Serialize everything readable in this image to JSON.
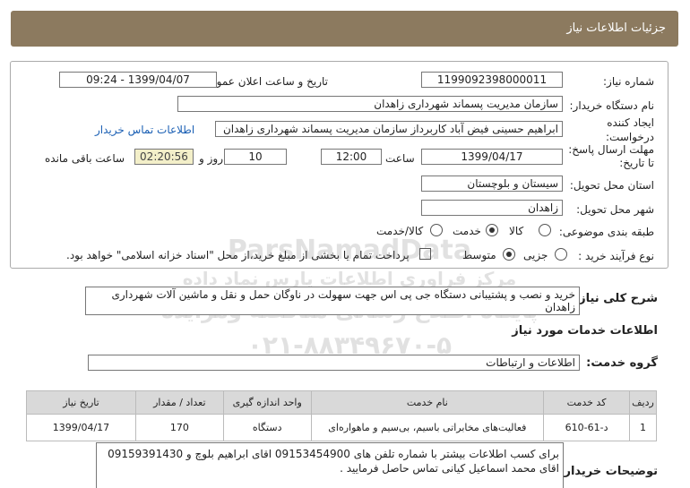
{
  "header": {
    "title": "جزئیات اطلاعات نیاز"
  },
  "need": {
    "number_label": "شماره نیاز:",
    "number": "1199092398000011",
    "announce_label": "تاریخ و ساعت اعلان عمومی:",
    "announce_value": "1399/04/07 - 09:24",
    "buyer_label": "نام دستگاه خریدار:",
    "buyer": "سازمان مدیریت پسماند شهرداری زاهدان",
    "creator_label_1": "ایجاد کننده",
    "creator_label_2": "درخواست:",
    "creator": "ابراهیم حسینی فیض آباد کاربرداز سازمان مدیریت پسماند شهرداری زاهدان",
    "contact_link": "اطلاعات تماس خریدار",
    "deadline_label_1": "مهلت ارسال پاسخ:",
    "deadline_label_2": "تا تاریخ:",
    "deadline_date": "1399/04/17",
    "time_label": "ساعت",
    "deadline_time": "12:00",
    "days_value": "10",
    "days_label": "روز و",
    "remaining_time": "02:20:56",
    "remaining_label": "ساعت باقی مانده",
    "province_label": "استان محل تحویل:",
    "province": "سیستان و بلوچستان",
    "city_label": "شهر محل تحویل:",
    "city": "زاهدان",
    "category_label": "طبقه بندی موضوعی:",
    "category_options": [
      "کالا",
      "خدمت",
      "کالا/خدمت"
    ],
    "category_selected": "خدمت",
    "process_label": "نوع فرآیند خرید :",
    "process_options": [
      "جزیی",
      "متوسط"
    ],
    "process_selected": "متوسط",
    "payment_note": "پرداخت تمام یا بخشی از مبلغ خرید،از محل \"اسناد خزانه اسلامی\" خواهد بود."
  },
  "summary": {
    "label": "شرح کلی نیاز:",
    "text": "خرید و نصب و پشتیبانی دستگاه جی پی اس جهت سهولت در ناوگان حمل و نقل و ماشین آلات شهرداری زاهدان"
  },
  "services_heading": "اطلاعات خدمات مورد نیاز",
  "service_group": {
    "label": "گروه خدمت:",
    "value": "اطلاعات و ارتباطات"
  },
  "table": {
    "headers": [
      "ردیف",
      "کد خدمت",
      "نام خدمت",
      "واحد اندازه گیری",
      "تعداد / مقدار",
      "تاریخ نیاز"
    ],
    "rows": [
      [
        "1",
        "د-61-610",
        "فعالیت‌های مخابراتی باسیم، بی‌سیم و ماهواره‌ای",
        "دستگاه",
        "170",
        "1399/04/17"
      ]
    ]
  },
  "buyer_notes": {
    "label": "توضیحات خریدار:",
    "text": "برای کسب اطلاعات بیشتر با شماره تلفن های 09153454900 اقای ابراهیم بلوچ و 09159391430 اقای محمد اسماعیل کیانی تماس حاصل فرمایید ."
  },
  "watermark": {
    "line1": "ParsNamadData",
    "line2": "مرکز فراوری اطلاعات پارس نماد داده",
    "line3": "پایگاه اطلاع رسانی مناقصه ومزایده",
    "line4": "۰۲۱-۸۸۳۴۹۶۷۰-۵"
  },
  "colors": {
    "titlebar": "#8c7a5f",
    "timer_bg": "#f3efc9",
    "link": "#1a5fb4"
  }
}
